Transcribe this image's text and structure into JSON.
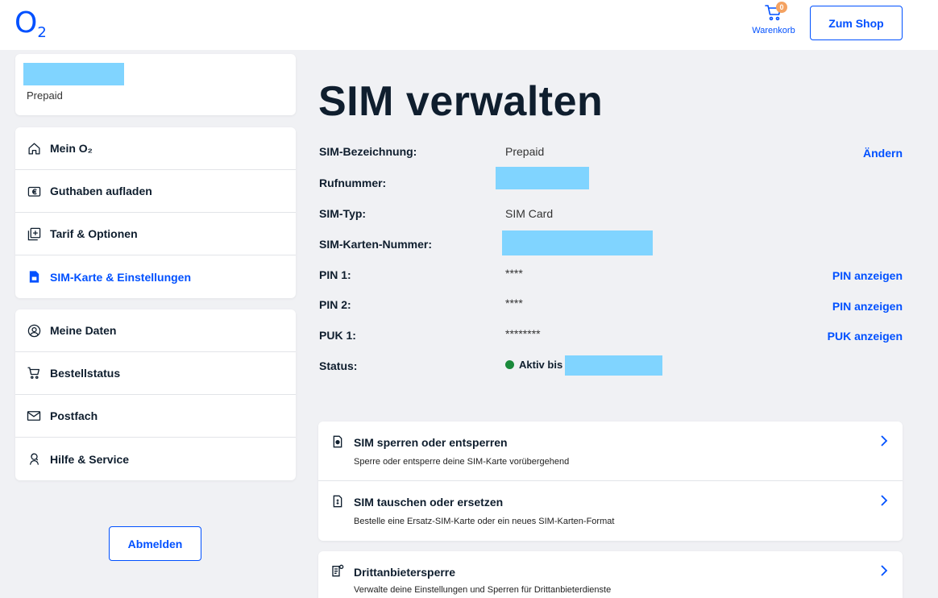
{
  "header": {
    "logo": "O",
    "logo_sub": "2",
    "cart_count": "0",
    "cart_label": "Warenkorb",
    "shop_button": "Zum Shop"
  },
  "account": {
    "type": "Prepaid"
  },
  "nav": {
    "group1": [
      {
        "label": "Mein O₂",
        "icon": "home-icon"
      },
      {
        "label": "Guthaben aufladen",
        "icon": "wallet-euro-icon"
      },
      {
        "label": "Tarif & Optionen",
        "icon": "add-layers-icon"
      },
      {
        "label": "SIM-Karte & Einstellungen",
        "icon": "sim-card-icon",
        "active": true
      }
    ],
    "group2": [
      {
        "label": "Meine Daten",
        "icon": "user-circle-icon"
      },
      {
        "label": "Bestellstatus",
        "icon": "cart-icon"
      },
      {
        "label": "Postfach",
        "icon": "mail-icon"
      },
      {
        "label": "Hilfe & Service",
        "icon": "support-person-icon"
      }
    ]
  },
  "logout_button": "Abmelden",
  "page_title": "SIM verwalten",
  "details": {
    "sim_name": {
      "label": "SIM-Bezeichnung:",
      "value": "Prepaid",
      "link": "Ändern"
    },
    "phone": {
      "label": "Rufnummer:"
    },
    "sim_type": {
      "label": "SIM-Typ:",
      "value": "SIM Card"
    },
    "sim_number": {
      "label": "SIM-Karten-Nummer:"
    },
    "pin1": {
      "label": "PIN 1:",
      "value": "****",
      "link": "PIN anzeigen"
    },
    "pin2": {
      "label": "PIN 2:",
      "value": "****",
      "link": "PIN anzeigen"
    },
    "puk1": {
      "label": "PUK 1:",
      "value": "********",
      "link": "PUK anzeigen"
    },
    "status": {
      "label": "Status:",
      "value": "Aktiv bis",
      "color": "#1a8a3b"
    }
  },
  "actions": [
    {
      "title": "SIM sperren oder entsperren",
      "subtitle": "Sperre oder entsperre deine SIM-Karte vorübergehend"
    },
    {
      "title": "SIM tauschen oder ersetzen",
      "subtitle": "Bestelle eine Ersatz-SIM-Karte oder ein neues SIM-Karten-Format"
    },
    {
      "title": "Drittanbietersperre",
      "subtitle": "Verwalte deine Einstellungen und Sperren für Drittanbieterdienste"
    }
  ],
  "colors": {
    "accent": "#0050ff",
    "redacted": "#80d4ff",
    "background": "#f0f1f4"
  }
}
